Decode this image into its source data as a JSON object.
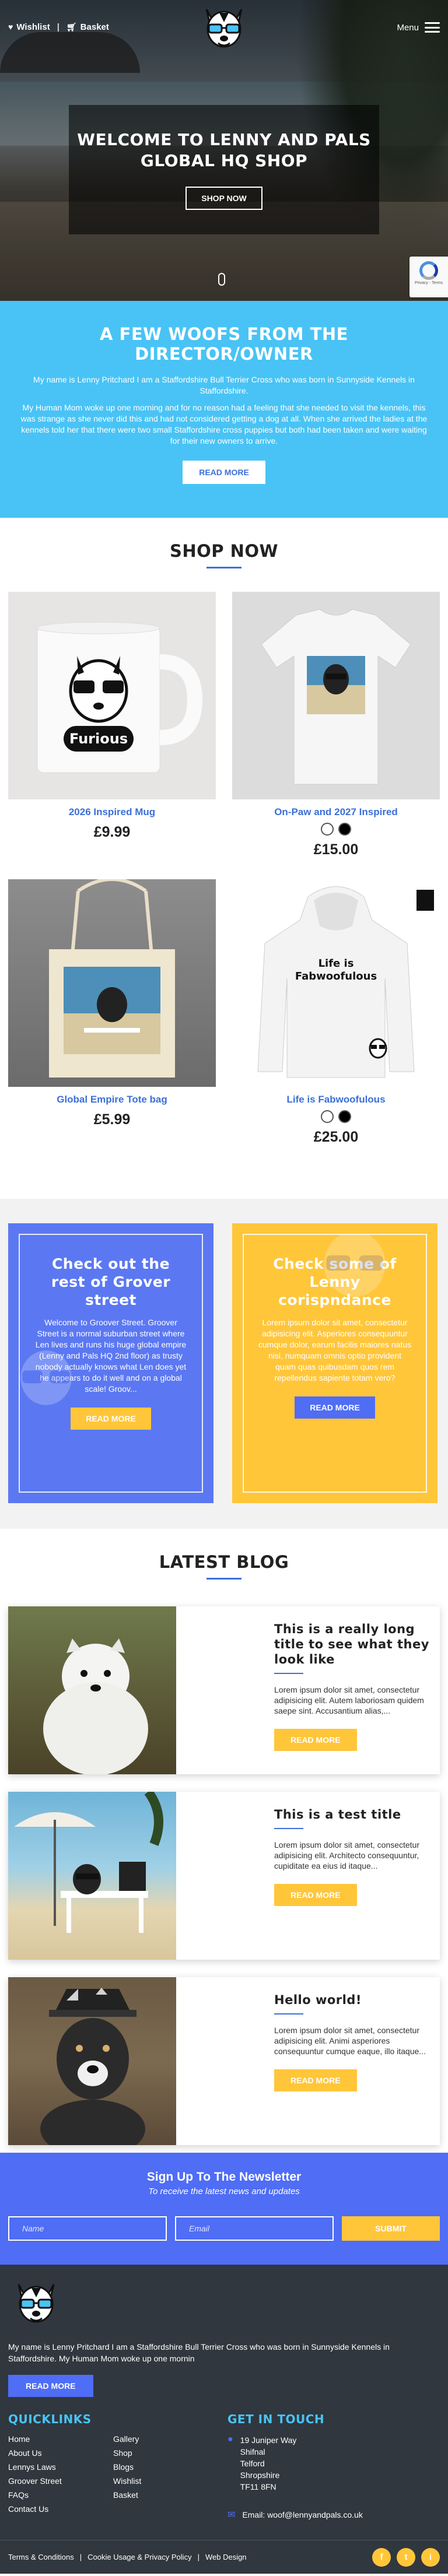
{
  "header": {
    "wishlist_label": "Wishlist",
    "basket_label": "Basket",
    "menu_label": "Menu"
  },
  "hero": {
    "title_line1": "WELCOME TO LENNY AND PALS",
    "title_line2": "GLOBAL HQ SHOP",
    "button_label": "SHOP NOW",
    "recaptcha_text": "Privacy - Terms"
  },
  "director": {
    "title": "A FEW WOOFS FROM THE DIRECTOR/OWNER",
    "para1": "My name is Lenny Pritchard I am a Staffordshire Bull Terrier Cross who was born in Sunnyside Kennels in Staffordshire.",
    "para2": "My Human Mom woke up one morning and for no reason had a feeling that she needed to visit the kennels, this was strange as she never did this and had not considered getting a dog at all. When she arrived the ladies at the kennels told her that there were two small Staffordshire cross puppies but both had been taken and were waiting for their new owners to arrive.",
    "button_label": "READ MORE"
  },
  "shop": {
    "title": "SHOP NOW",
    "products": [
      {
        "name": "2026 Inspired Mug",
        "price": "£9.99",
        "mug_text": "Furious"
      },
      {
        "name": "On-Paw and 2027 Inspired",
        "price": "£15.00"
      },
      {
        "name": "Global Empire Tote bag",
        "price": "£5.99"
      },
      {
        "name": "Life is Fabwoofulous",
        "price": "£25.00",
        "hoodie_text_1": "Life is",
        "hoodie_text_2": "Fabwoofulous"
      }
    ],
    "swatch_colors": [
      "#ffffff",
      "#000000"
    ]
  },
  "promo": {
    "left": {
      "title": "Check out the rest of Grover street",
      "text": "Welcome to Groover Street. Groover Street is a normal suburban street where Len lives and runs his huge global empire (Lenny and Pals HQ 2nd floor) as trusty nobody actually knows what Len does yet he appears to do it well and on a global scale! Groov...",
      "button_label": "READ MORE",
      "color": "#5b78f2"
    },
    "right": {
      "title": "Check some of Lenny corispndance",
      "text": "Lorem ipsum dolor sit amet, consectetur adipisicing elit. Asperiores consequuntur cumque dolor, earum facilis maiores natus nisi, numquam omnis optio provident quam quas quibusdam quos rem repellendus sapiente totam vero?",
      "button_label": "READ MORE",
      "color": "#ffc63a"
    }
  },
  "blog": {
    "title": "LATEST BLOG",
    "posts": [
      {
        "title": "This is a really long title to see what they look like",
        "excerpt": "Lorem ipsum dolor sit amet, consectetur adipisicing elit. Autem laboriosam quidem saepe sint. Accusantium alias,...",
        "button_label": "READ MORE"
      },
      {
        "title": "This is a test title",
        "excerpt": "Lorem ipsum dolor sit amet, consectetur adipisicing elit. Architecto consequuntur, cupiditate ea eius id itaque...",
        "button_label": "READ MORE"
      },
      {
        "title": "Hello world!",
        "excerpt": "Lorem ipsum dolor sit amet, consectetur adipisicing elit. Animi asperiores consequuntur cumque eaque, illo itaque...",
        "button_label": "READ MORE"
      }
    ]
  },
  "newsletter": {
    "title": "Sign Up To The Newsletter",
    "subtitle": "To receive the latest news and updates",
    "name_placeholder": "Name",
    "email_placeholder": "Email",
    "submit_label": "SUBMIT"
  },
  "footer": {
    "about": "My name is Lenny Pritchard I am a Staffordshire Bull Terrier Cross who was born in Sunnyside Kennels in Staffordshire. My Human Mom woke up one mornin",
    "read_more_label": "READ MORE",
    "quicklinks_title": "QUICKLINKS",
    "quicklinks": [
      "Home",
      "Gallery",
      "About Us",
      "Shop",
      "Lennys Laws",
      "Blogs",
      "Groover Street",
      "Wishlist",
      "FAQs",
      "Basket",
      "Contact Us"
    ],
    "get_in_touch_title": "GET IN TOUCH",
    "address": [
      "19 Juniper Way",
      "Shifnal",
      "Telford",
      "Shropshire",
      "TF11 8FN"
    ],
    "email": "Email: woof@lennyandpals.co.uk",
    "legal": [
      "Terms & Conditions",
      "|",
      "Cookie Usage & Privacy Policy",
      "|",
      "Web Design"
    ],
    "socials": [
      "f",
      "t",
      "i"
    ]
  }
}
